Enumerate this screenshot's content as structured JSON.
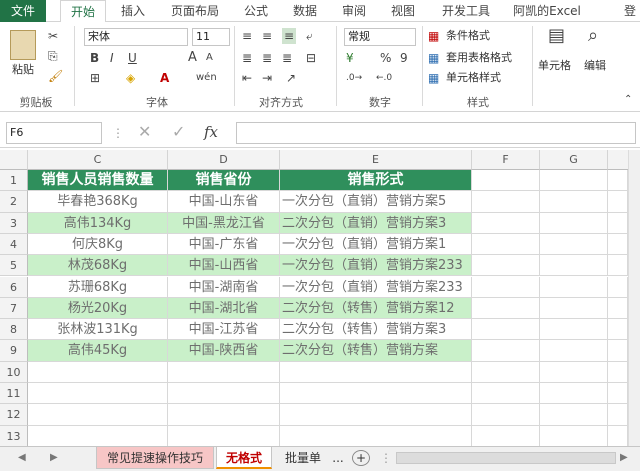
{
  "ribbon_tabs": [
    "文件",
    "开始",
    "插入",
    "页面布局",
    "公式",
    "数据",
    "审阅",
    "视图",
    "开发工具",
    "阿凯的Excel",
    "登"
  ],
  "ribbon": {
    "paste": "粘贴",
    "font_name": "宋体",
    "font_size": "11",
    "bold": "B",
    "italic": "I",
    "underline": "U",
    "grow": "A",
    "shrink": "A",
    "number_format": "常规",
    "percent": "%",
    "comma": "9",
    "cond_format": "条件格式",
    "table_format": "套用表格格式",
    "cell_style": "单元格样式",
    "cells": "单元格",
    "edit": "编辑",
    "groups": [
      "剪贴板",
      "字体",
      "对齐方式",
      "数字",
      "样式"
    ]
  },
  "formula_bar": {
    "name_box": "F6",
    "fx": "fx",
    "value": ""
  },
  "columns": [
    "C",
    "D",
    "E",
    "F",
    "G"
  ],
  "rows": [
    "1",
    "2",
    "3",
    "4",
    "5",
    "6",
    "7",
    "8",
    "9",
    "10",
    "11",
    "12",
    "13",
    "14"
  ],
  "table": {
    "headers": [
      "销售人员销售数量",
      "销售省份",
      "销售形式"
    ],
    "data": [
      [
        "毕春艳368Kg",
        "中国-山东省",
        "一次分包（直销）营销方案5"
      ],
      [
        "高伟134Kg",
        "中国-黑龙江省",
        "二次分包（直销）营销方案3"
      ],
      [
        "何庆8Kg",
        "中国-广东省",
        "一次分包（直销）营销方案1"
      ],
      [
        "林茂68Kg",
        "中国-山西省",
        "一次分包（直销）营销方案233"
      ],
      [
        "苏珊68Kg",
        "中国-湖南省",
        "一次分包（直销）营销方案233"
      ],
      [
        "杨光20Kg",
        "中国-湖北省",
        "二次分包（转售）营销方案12"
      ],
      [
        "张林波131Kg",
        "中国-江苏省",
        "二次分包（转售）营销方案3"
      ],
      [
        "高伟45Kg",
        "中国-陕西省",
        "二次分包（转售）营销方案"
      ]
    ]
  },
  "sheets": [
    "常见提速操作技巧",
    "无格式",
    "批量单"
  ],
  "sheet_more": "...",
  "add_sheet": "+",
  "colors": {
    "header_fill": "#2f8f5c",
    "stripe": "#c9f0c9",
    "excel_green": "#217346"
  }
}
